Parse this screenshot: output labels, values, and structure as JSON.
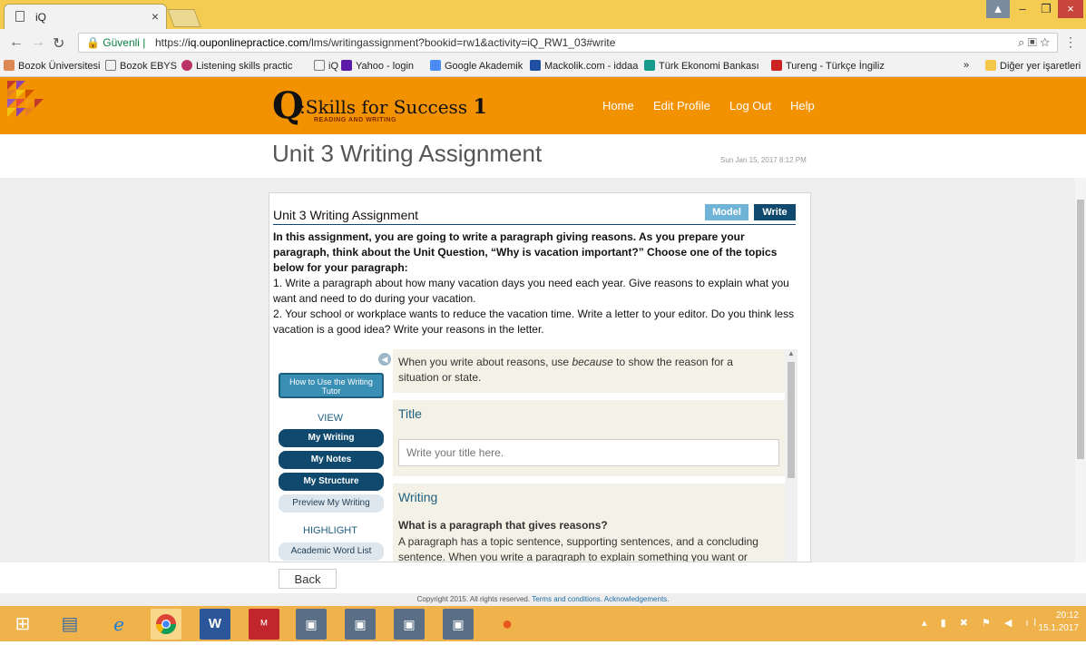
{
  "browser": {
    "tab_title": "iQ",
    "tab_close": "×",
    "secure_label": "Güvenli",
    "url_scheme": "https://",
    "url_host": "iq.ouponlinepractice.com",
    "url_path": "/lms/writingassignment?bookid=rw1&activity=iQ_RW1_03#write",
    "window_controls": [
      "–",
      "❐",
      "×"
    ],
    "bookmarks": [
      {
        "label": "Bozok Üniversitesi",
        "icon": "bozok-icon"
      },
      {
        "label": "Bozok EBYS",
        "icon": "page-icon"
      },
      {
        "label": "Listening skills practic",
        "icon": "dots-icon"
      },
      {
        "label": "iQ",
        "icon": "page-icon"
      },
      {
        "label": "Yahoo - login",
        "icon": "yahoo-icon"
      },
      {
        "label": "Google Akademik",
        "icon": "scholar-icon"
      },
      {
        "label": "Mackolik.com - iddaa",
        "icon": "mackolik-icon"
      },
      {
        "label": "Türk Ekonomi Bankası",
        "icon": "teb-icon"
      },
      {
        "label": "Tureng - Türkçe İngiliz",
        "icon": "tureng-icon"
      }
    ],
    "bookmarks_overflow": "»",
    "other_bookmarks": "Diğer yer işaretleri"
  },
  "site": {
    "brand_letter": "Q",
    "brand_name": ":Skills for Success",
    "brand_level": "1",
    "brand_sub": "READING AND WRITING",
    "nav": [
      "Home",
      "Edit Profile",
      "Log Out",
      "Help"
    ]
  },
  "page": {
    "title": "Unit 3 Writing Assignment",
    "date": "Sun Jan 15, 2017 8:12 PM"
  },
  "panel": {
    "title": "Unit 3 Writing Assignment",
    "model_label": "Model",
    "write_label": "Write",
    "instructions_bold": "In this assignment, you are going to write a paragraph giving reasons.  As you prepare your paragraph, think about the Unit Question, “Why is vacation important?”  Choose one of the topics below for your paragraph:",
    "topic1": "1. Write a paragraph about how many vacation days you need each year.  Give reasons to explain what you want and need to do during your vacation.",
    "topic2": "2. Your school or workplace wants to reduce the vacation time. Write a letter to your editor. Do you think less vacation is a good idea?  Write your reasons in the letter."
  },
  "sidebar": {
    "howto_label": "How to Use the Writing Tutor",
    "view_label": "VIEW",
    "view_items": [
      "My Writing",
      "My Notes",
      "My Structure",
      "Preview My Writing"
    ],
    "highlight_label": "HIGHLIGHT",
    "highlight_items": [
      "Academic Word List"
    ]
  },
  "content": {
    "tip_before": "When you write about reasons, use ",
    "tip_italic": "because",
    "tip_after": " to show the reason for a situation or state.",
    "title_heading": "Title",
    "title_placeholder": "Write your title here.",
    "writing_heading": "Writing",
    "writing_question": "What is a paragraph that gives reasons?",
    "writing_body": "A paragraph has a topic sentence, supporting sentences, and a concluding sentence.  When you write a paragraph to explain something you want or"
  },
  "back_label": "Back",
  "footer": {
    "copyright": "Copyright 2015. All rights reserved.",
    "terms": "Terms and conditions.",
    "ack": "Acknowledgements."
  },
  "taskbar": {
    "time": "20:12",
    "date": "15.1.2017"
  },
  "colors": {
    "header_orange": "#f39200",
    "nav_dark_blue": "#0f4a6e",
    "model_button": "#6fb3d6",
    "write_button": "#0f4a6e"
  }
}
